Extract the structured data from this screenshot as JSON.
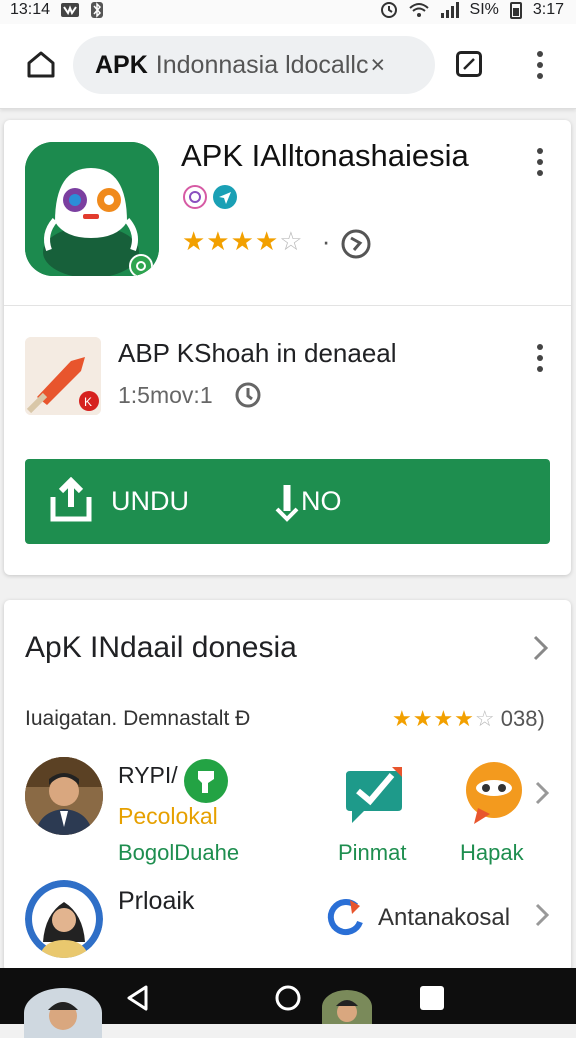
{
  "status_bar": {
    "left_time": "13:14",
    "battery_text": "SI%",
    "right_time": "3:17"
  },
  "browser": {
    "url_bold": "APK",
    "url_rest": "Indonnasia ldocallc",
    "clear_glyph": "×"
  },
  "app": {
    "title": "APK IAlltonashaiesia",
    "rating_stars": "★★★",
    "rating_half": "★",
    "rating_empty": "☆",
    "dot": "·"
  },
  "related_item": {
    "title": "ABP KShoah in denaeal",
    "subtitle": "1:5mov:1"
  },
  "download_button": {
    "left_label": "UNDU",
    "right_label": "NO"
  },
  "section": {
    "title": "ApK INdaail donesia",
    "subtitle": "Iuaigatan. Demnastalt Ð",
    "rating_stars": "★★★",
    "rating_half": "★",
    "rating_empty": "☆",
    "rating_value": "038)"
  },
  "people": [
    {
      "name": "RYPI/",
      "role": "Pecolokal",
      "tag": "BogolDuahe"
    },
    {
      "name": "Prloaik"
    }
  ],
  "apps": [
    {
      "label": "Pinmat"
    },
    {
      "label": "Hapak"
    },
    {
      "label": "Antanakosal"
    }
  ],
  "colors": {
    "brand_green": "#1e8e4f",
    "star_orange": "#f2a000",
    "nav_black": "#0e0e0e"
  }
}
